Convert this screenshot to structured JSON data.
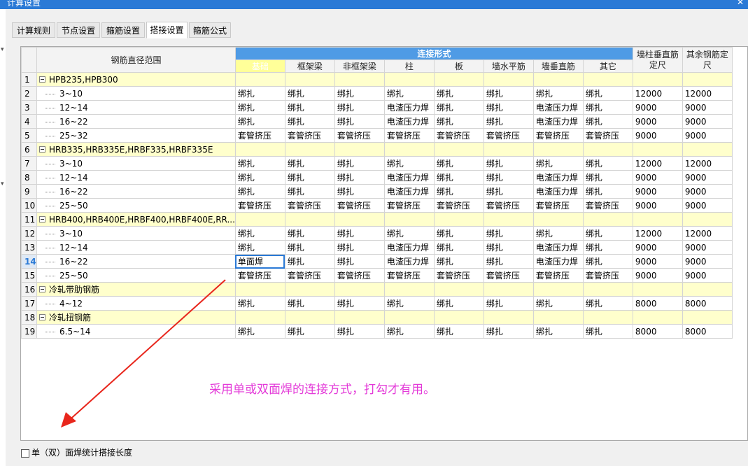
{
  "window": {
    "title": "计算设置"
  },
  "tabs": [
    {
      "label": "计算规则",
      "active": false
    },
    {
      "label": "节点设置",
      "active": false
    },
    {
      "label": "箍筋设置",
      "active": false
    },
    {
      "label": "搭接设置",
      "active": true
    },
    {
      "label": "箍筋公式",
      "active": false
    }
  ],
  "grid": {
    "header": {
      "range": "钢筋直径范围",
      "connection_form": "连接形式",
      "sub": [
        "基础",
        "框架梁",
        "非框架梁",
        "柱",
        "板",
        "墙水平筋",
        "墙垂直筋",
        "其它"
      ],
      "col_wall": "墙柱垂直筋定尺",
      "col_other": "其余钢筋定尺"
    },
    "rows": [
      {
        "num": "1",
        "group": true,
        "label": "HPB235,HPB300"
      },
      {
        "num": "2",
        "label": "3~10",
        "cells": [
          "绑扎",
          "绑扎",
          "绑扎",
          "绑扎",
          "绑扎",
          "绑扎",
          "绑扎",
          "绑扎"
        ],
        "wall": "12000",
        "other": "12000"
      },
      {
        "num": "3",
        "label": "12~14",
        "cells": [
          "绑扎",
          "绑扎",
          "绑扎",
          "电渣压力焊",
          "绑扎",
          "绑扎",
          "电渣压力焊",
          "绑扎"
        ],
        "wall": "9000",
        "other": "9000"
      },
      {
        "num": "4",
        "label": "16~22",
        "cells": [
          "绑扎",
          "绑扎",
          "绑扎",
          "电渣压力焊",
          "绑扎",
          "绑扎",
          "电渣压力焊",
          "绑扎"
        ],
        "wall": "9000",
        "other": "9000"
      },
      {
        "num": "5",
        "label": "25~32",
        "cells": [
          "套管挤压",
          "套管挤压",
          "套管挤压",
          "套管挤压",
          "套管挤压",
          "套管挤压",
          "套管挤压",
          "套管挤压"
        ],
        "wall": "9000",
        "other": "9000"
      },
      {
        "num": "6",
        "group": true,
        "label": "HRB335,HRB335E,HRBF335,HRBF335E"
      },
      {
        "num": "7",
        "label": "3~10",
        "cells": [
          "绑扎",
          "绑扎",
          "绑扎",
          "绑扎",
          "绑扎",
          "绑扎",
          "绑扎",
          "绑扎"
        ],
        "wall": "12000",
        "other": "12000"
      },
      {
        "num": "8",
        "label": "12~14",
        "cells": [
          "绑扎",
          "绑扎",
          "绑扎",
          "电渣压力焊",
          "绑扎",
          "绑扎",
          "电渣压力焊",
          "绑扎"
        ],
        "wall": "9000",
        "other": "9000"
      },
      {
        "num": "9",
        "label": "16~22",
        "cells": [
          "绑扎",
          "绑扎",
          "绑扎",
          "电渣压力焊",
          "绑扎",
          "绑扎",
          "电渣压力焊",
          "绑扎"
        ],
        "wall": "9000",
        "other": "9000"
      },
      {
        "num": "10",
        "label": "25~50",
        "cells": [
          "套管挤压",
          "套管挤压",
          "套管挤压",
          "套管挤压",
          "套管挤压",
          "套管挤压",
          "套管挤压",
          "套管挤压"
        ],
        "wall": "9000",
        "other": "9000"
      },
      {
        "num": "11",
        "group": true,
        "label": "HRB400,HRB400E,HRBF400,HRBF400E,RR..."
      },
      {
        "num": "12",
        "label": "3~10",
        "cells": [
          "绑扎",
          "绑扎",
          "绑扎",
          "绑扎",
          "绑扎",
          "绑扎",
          "绑扎",
          "绑扎"
        ],
        "wall": "12000",
        "other": "12000"
      },
      {
        "num": "13",
        "label": "12~14",
        "cells": [
          "绑扎",
          "绑扎",
          "绑扎",
          "电渣压力焊",
          "绑扎",
          "绑扎",
          "电渣压力焊",
          "绑扎"
        ],
        "wall": "9000",
        "other": "9000"
      },
      {
        "num": "14",
        "label": "16~22",
        "current": true,
        "cells": [
          "单面焊",
          "绑扎",
          "绑扎",
          "电渣压力焊",
          "绑扎",
          "绑扎",
          "电渣压力焊",
          "绑扎"
        ],
        "wall": "9000",
        "other": "9000"
      },
      {
        "num": "15",
        "label": "25~50",
        "cells": [
          "套管挤压",
          "套管挤压",
          "套管挤压",
          "套管挤压",
          "套管挤压",
          "套管挤压",
          "套管挤压",
          "套管挤压"
        ],
        "wall": "9000",
        "other": "9000"
      },
      {
        "num": "16",
        "group": true,
        "label": "冷轧带肋钢筋"
      },
      {
        "num": "17",
        "label": "4~12",
        "cells": [
          "绑扎",
          "绑扎",
          "绑扎",
          "绑扎",
          "绑扎",
          "绑扎",
          "绑扎",
          "绑扎"
        ],
        "wall": "8000",
        "other": "8000"
      },
      {
        "num": "18",
        "group": true,
        "label": "冷轧扭钢筋"
      },
      {
        "num": "19",
        "label": "6.5~14",
        "cells": [
          "绑扎",
          "绑扎",
          "绑扎",
          "绑扎",
          "绑扎",
          "绑扎",
          "绑扎",
          "绑扎"
        ],
        "wall": "8000",
        "other": "8000"
      }
    ]
  },
  "annotation": {
    "text": "采用单或双面焊的连接方式，打勾才有用。",
    "color": "#e339d8"
  },
  "footer": {
    "checkbox_label": "单（双）面焊统计搭接长度",
    "checked": false
  },
  "colors": {
    "title_bar": "#2b7ad6",
    "header_accent": "#4f9be5",
    "group_row": "#ffffcc",
    "arrow": "#e8261c"
  }
}
